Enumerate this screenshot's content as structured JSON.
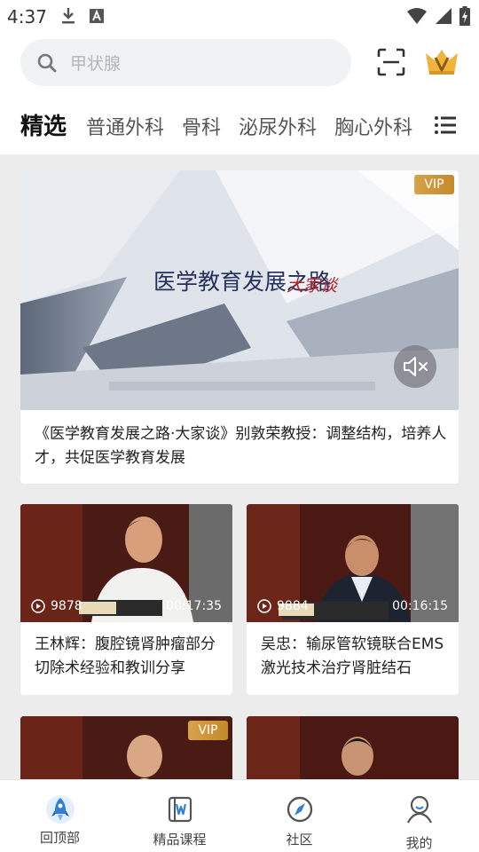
{
  "status_bar": {
    "time": "4:37",
    "icons": [
      "download-icon",
      "text-notification-icon",
      "wifi-icon",
      "cellular-icon",
      "battery-icon"
    ]
  },
  "search": {
    "placeholder": "甲状腺"
  },
  "header_icons": [
    "scan-icon",
    "vip-crown-icon"
  ],
  "tabs": [
    "精选",
    "普通外科",
    "骨科",
    "泌尿外科",
    "胸心外科"
  ],
  "featured": {
    "vip_badge": "VIP",
    "title": "《医学教育发展之路·大家谈》别敦荣教授：调整结构，培养人才，共促医学教育发展",
    "banner_text": "医学教育发展之路",
    "banner_text_accent": "大家谈"
  },
  "videos": [
    {
      "views": "9878",
      "duration": "00:17:35",
      "title": "王林辉：腹腔镜肾肿瘤部分切除术经验和教训分享",
      "vip": false
    },
    {
      "views": "9884",
      "duration": "00:16:15",
      "title": "吴忠：输尿管软镜联合EMS激光技术治疗肾脏结石",
      "vip": false
    },
    {
      "views": "",
      "duration": "",
      "title": "",
      "vip": true,
      "vip_badge": "VIP"
    },
    {
      "views": "",
      "duration": "",
      "title": "",
      "vip": false
    }
  ],
  "bottom_nav": [
    {
      "label": "回顶部",
      "icon": "rocket-icon"
    },
    {
      "label": "精品课程",
      "icon": "course-book-icon"
    },
    {
      "label": "社区",
      "icon": "compass-icon"
    },
    {
      "label": "我的",
      "icon": "profile-icon"
    }
  ],
  "colors": {
    "vip_gold": "#c9922f",
    "accent_blue": "#2f7fd6",
    "background": "#ececec"
  }
}
